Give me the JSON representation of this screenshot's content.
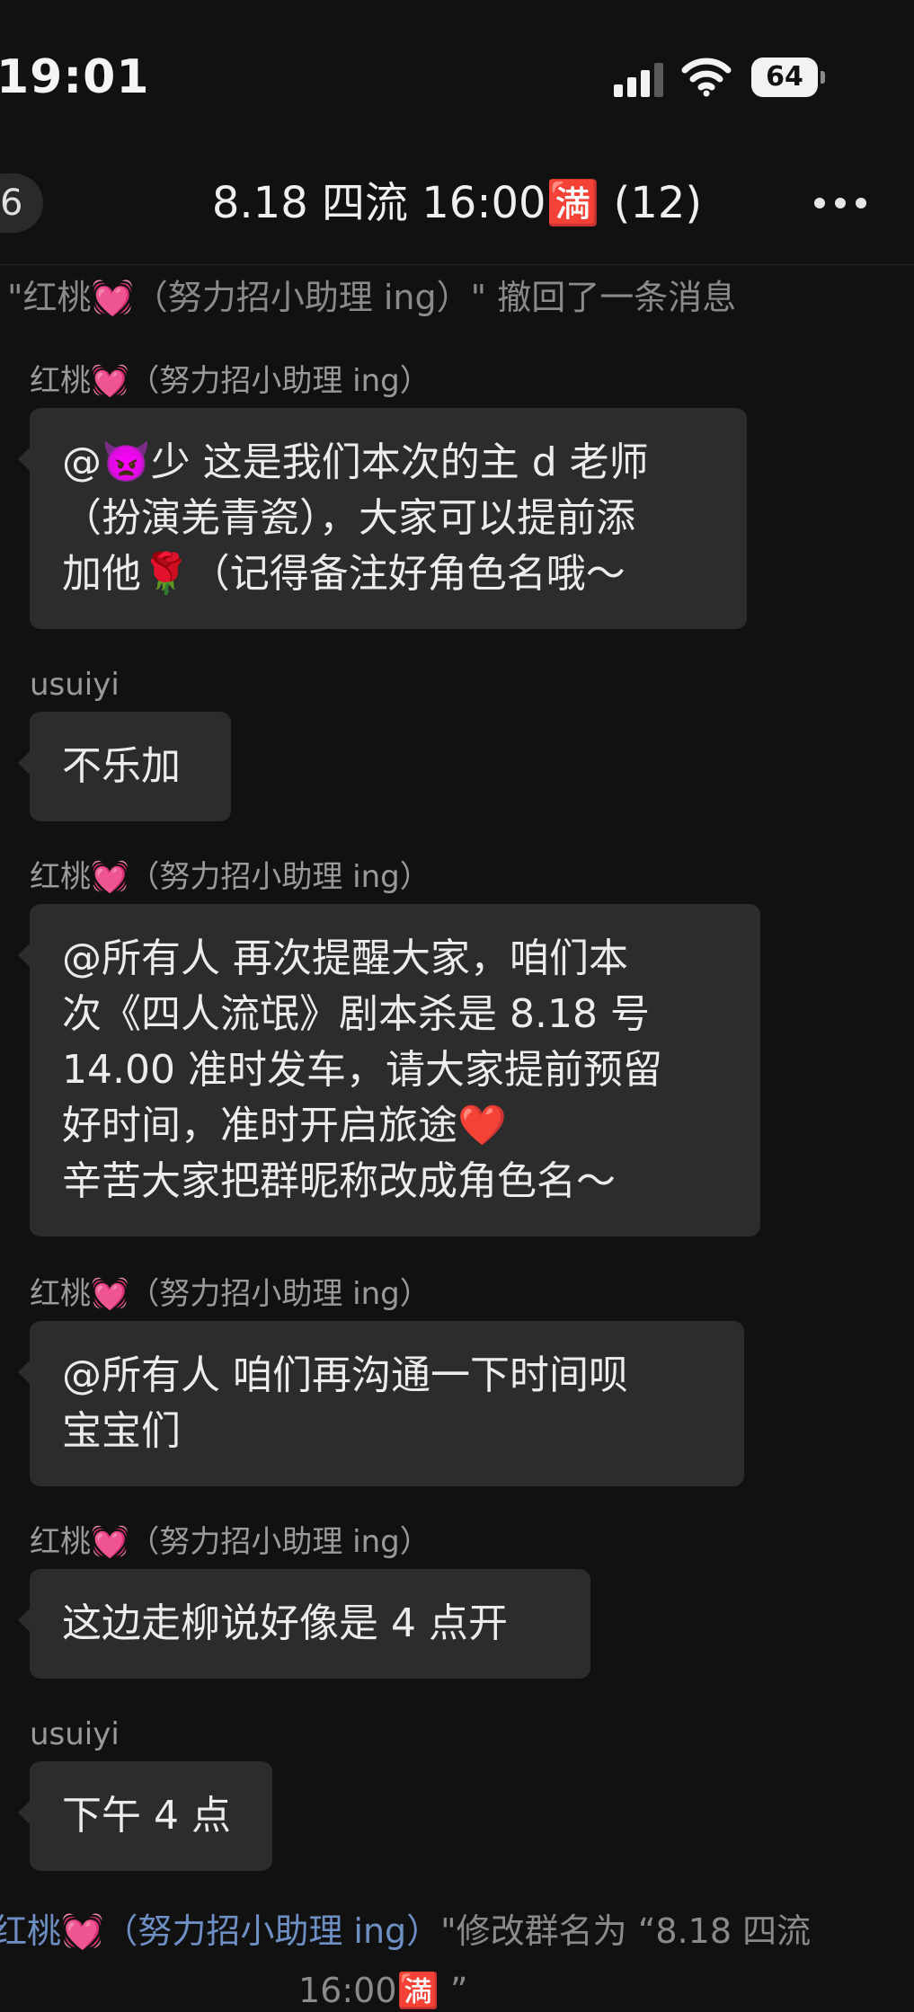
{
  "status_bar": {
    "time": "19:01",
    "battery": "64"
  },
  "nav": {
    "back_count": "6",
    "title": "8.18 四流 16:00🈵 (12)",
    "more_icon": "more-horizontal-icon"
  },
  "notices": [
    {
      "text": "\"红桃💓（努力招小助理 ing）\" 撤回了一条消息"
    },
    {
      "name": "红桃💓（努力招小助理 ing）",
      "text_line1": "\"修改群名为 “8.18 四流",
      "text_line2": "16:00🈵 ”"
    }
  ],
  "messages": [
    {
      "sender": "红桃💓（努力招小助理 ing）",
      "text": "@👿少 这是我们本次的主 d 老师\n（扮演羌青瓷），大家可以提前添\n加他🌹（记得备注好角色名哦～"
    },
    {
      "sender": "usuiyi",
      "text": "不乐加"
    },
    {
      "sender": "红桃💓（努力招小助理 ing）",
      "text": "@所有人  再次提醒大家，咱们本\n次《四人流氓》剧本杀是 8.18 号\n14.00 准时发车，请大家提前预留\n好时间，准时开启旅途❤️\n辛苦大家把群昵称改成角色名～"
    },
    {
      "sender": "红桃💓（努力招小助理 ing）",
      "text": "@所有人 咱们再沟通一下时间呗\n宝宝们"
    },
    {
      "sender": "红桃💓（努力招小助理 ing）",
      "text": "这边走柳说好像是 4 点开"
    },
    {
      "sender": "usuiyi",
      "text": "下午 4 点"
    }
  ],
  "colors": {
    "background": "#111111",
    "bubble": "#2c2c2c",
    "system_name": "#6d8fc3"
  }
}
